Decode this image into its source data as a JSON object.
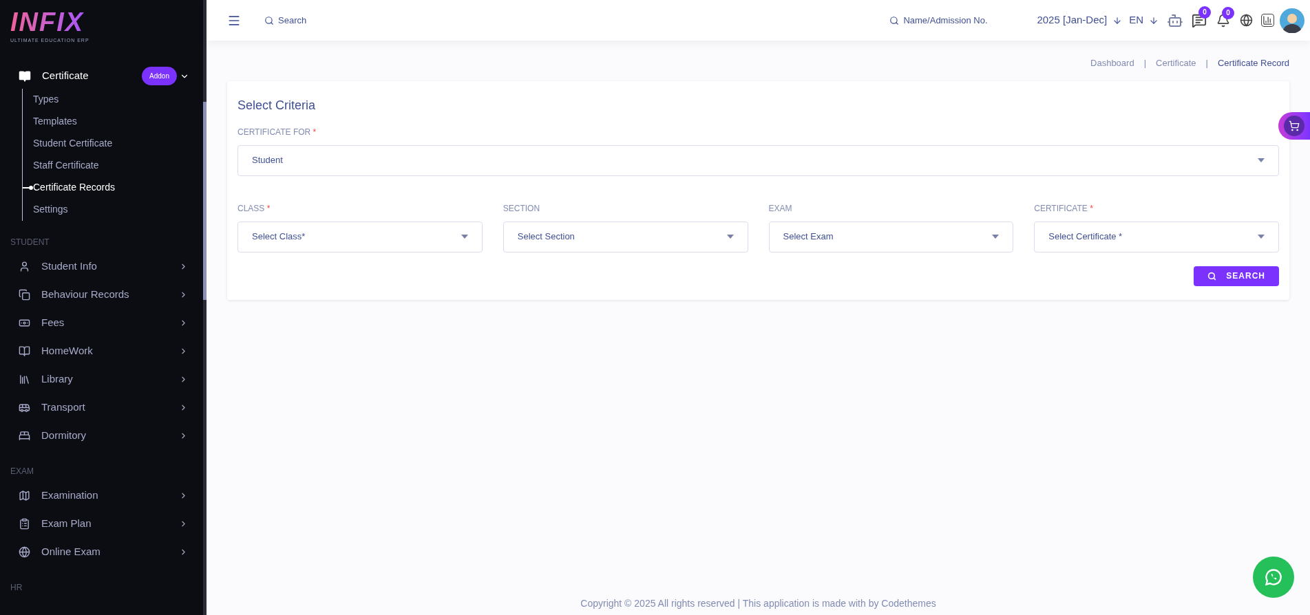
{
  "logo": {
    "name": "INFIX",
    "tagline": "ULTIMATE EDUCATION ERP"
  },
  "sidebar": {
    "active_menu": {
      "label": "Certificate",
      "badge": "Addon",
      "expanded": true,
      "children": [
        {
          "label": "Types",
          "selected": false
        },
        {
          "label": "Templates",
          "selected": false
        },
        {
          "label": "Student Certificate",
          "selected": false
        },
        {
          "label": "Staff Certificate",
          "selected": false
        },
        {
          "label": "Certificate Records",
          "selected": true
        },
        {
          "label": "Settings",
          "selected": false
        }
      ]
    },
    "sections": [
      {
        "title": "STUDENT",
        "items": [
          {
            "label": "Student Info"
          },
          {
            "label": "Behaviour Records"
          },
          {
            "label": "Fees"
          },
          {
            "label": "HomeWork"
          },
          {
            "label": "Library"
          },
          {
            "label": "Transport"
          },
          {
            "label": "Dormitory"
          }
        ]
      },
      {
        "title": "EXAM",
        "items": [
          {
            "label": "Examination"
          },
          {
            "label": "Exam Plan"
          },
          {
            "label": "Online Exam"
          }
        ]
      },
      {
        "title": "HR"
      }
    ]
  },
  "header": {
    "search": {
      "placeholder": "Search"
    },
    "student_search": {
      "placeholder": "Name/Admission No."
    },
    "session": "2025 [Jan-Dec]",
    "language": "EN",
    "messages_badge": "0",
    "notifications_badge": "0"
  },
  "breadcrumb_separator": "|",
  "breadcrumb": [
    {
      "label": "Dashboard",
      "selected": false
    },
    {
      "label": "Certificate",
      "selected": false
    },
    {
      "label": "Certificate Record",
      "selected": true
    }
  ],
  "form": {
    "title": "Select Criteria",
    "required_mark": "*",
    "certificate_for": {
      "label": "CERTIFICATE FOR",
      "required": true,
      "value": "Student"
    },
    "fields": [
      {
        "label": "CLASS",
        "required": true,
        "placeholder": "Select Class*"
      },
      {
        "label": "SECTION",
        "required": false,
        "placeholder": "Select Section"
      },
      {
        "label": "EXAM",
        "required": false,
        "placeholder": "Select Exam"
      },
      {
        "label": "CERTIFICATE",
        "required": true,
        "placeholder": "Select Certificate *"
      }
    ],
    "search_button": "SEARCH"
  },
  "footer": "Copyright © 2025 All rights reserved | This application is made with by Codethemes"
}
